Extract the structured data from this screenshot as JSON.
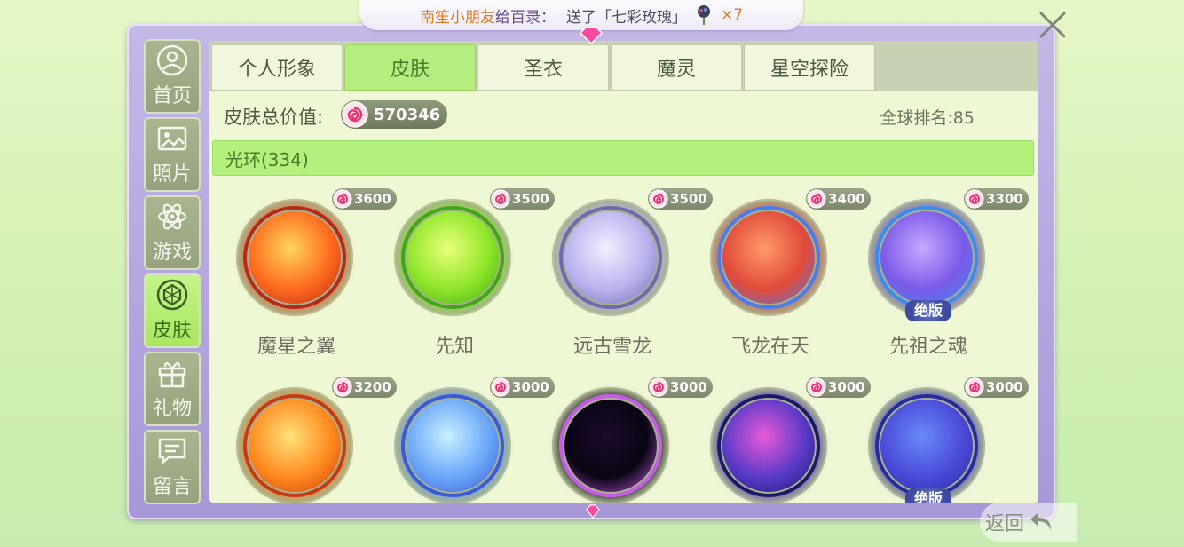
{
  "banner": {
    "sender": "南笙小朋友",
    "verb": "给百录：",
    "message": "送了「七彩玫瑰」",
    "count": "×7"
  },
  "sidebar": {
    "items": [
      {
        "label": "首页",
        "icon": "user-icon",
        "active": false
      },
      {
        "label": "照片",
        "icon": "photo-icon",
        "active": false
      },
      {
        "label": "游戏",
        "icon": "atom-icon",
        "active": false
      },
      {
        "label": "皮肤",
        "icon": "diamond-icon",
        "active": true
      },
      {
        "label": "礼物",
        "icon": "gift-icon",
        "active": false
      },
      {
        "label": "留言",
        "icon": "message-icon",
        "active": false
      }
    ]
  },
  "tabs": [
    {
      "label": "个人形象",
      "active": false
    },
    {
      "label": "皮肤",
      "active": true
    },
    {
      "label": "圣衣",
      "active": false
    },
    {
      "label": "魔灵",
      "active": false
    },
    {
      "label": "星空探险",
      "active": false
    }
  ],
  "stats": {
    "total_label": "皮肤总价值:",
    "total_value": "570346",
    "rank": "全球排名:85"
  },
  "section": {
    "title": "光环(334)"
  },
  "items": [
    {
      "name": "魔星之翼",
      "price": "3600",
      "badge": "",
      "colors": [
        "#ffd65a",
        "#ff6a1e",
        "#b6281a"
      ]
    },
    {
      "name": "先知",
      "price": "3500",
      "badge": "",
      "colors": [
        "#eaff7a",
        "#8ee62a",
        "#3fa814"
      ]
    },
    {
      "name": "远古雪龙",
      "price": "3500",
      "badge": "",
      "colors": [
        "#f4eeff",
        "#b9b2ee",
        "#6e6ab0"
      ]
    },
    {
      "name": "飞龙在天",
      "price": "3400",
      "badge": "",
      "colors": [
        "#ff9a6a",
        "#e04a3a",
        "#4a7cf0"
      ]
    },
    {
      "name": "先祖之魂",
      "price": "3300",
      "badge": "绝版",
      "colors": [
        "#c8a8ff",
        "#7a5ae8",
        "#3a8cf0"
      ]
    },
    {
      "name": "",
      "price": "3200",
      "badge": "",
      "colors": [
        "#ffe27a",
        "#ff8a1e",
        "#c83a14"
      ]
    },
    {
      "name": "",
      "price": "3000",
      "badge": "",
      "colors": [
        "#c8f0ff",
        "#6aa6f8",
        "#3a5ad8"
      ]
    },
    {
      "name": "",
      "price": "3000",
      "badge": "",
      "colors": [
        "#1a0a2a",
        "#0a0614",
        "#c85ae8"
      ]
    },
    {
      "name": "",
      "price": "3000",
      "badge": "",
      "colors": [
        "#e85ad8",
        "#5a3ac8",
        "#1a1a6a"
      ]
    },
    {
      "name": "",
      "price": "3000",
      "badge": "绝版",
      "colors": [
        "#6a8af8",
        "#4a4ad8",
        "#2a2aa0"
      ]
    }
  ],
  "back": {
    "label": "返回"
  }
}
